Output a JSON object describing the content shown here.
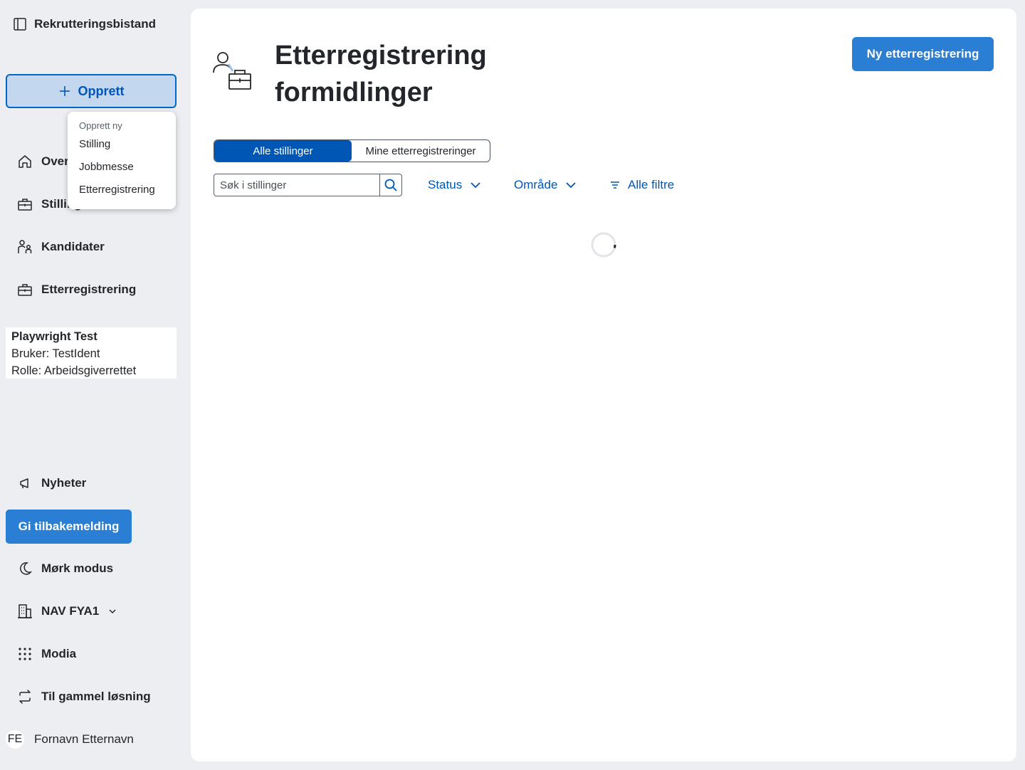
{
  "app": {
    "brand": "Rekrutteringsbistand"
  },
  "sidebar": {
    "create_label": "Opprett",
    "nav": {
      "oversikt": "Oversikt",
      "stillinger": "Stillinger",
      "kandidater": "Kandidater",
      "etterregistrering": "Etterregistrering"
    },
    "user_card": {
      "name": "Playwright Test",
      "user": "Bruker: TestIdent",
      "role": "Rolle: Arbeidsgiverrettet"
    },
    "nyheter": "Nyheter",
    "feedback": "Gi tilbakemelding",
    "dark_mode": "Mørk modus",
    "office": "NAV FYA1",
    "apps": "Modia",
    "old_solution": "Til gammel løsning",
    "avatar_initials": "FE",
    "user_full_name": "Fornavn Etternavn"
  },
  "dropdown": {
    "header": "Opprett ny",
    "options": [
      "Stilling",
      "Jobbmesse",
      "Etterregistrering"
    ]
  },
  "main": {
    "title": "Etterregistrering formidlinger",
    "new_button": "Ny etterregistrering",
    "tabs": [
      "Alle stillinger",
      "Mine etterregistreringer"
    ],
    "active_tab": "Alle stillinger",
    "search_placeholder": "Søk i stillinger",
    "filters": {
      "status": "Status",
      "area": "Område",
      "all": "Alle filtre"
    }
  },
  "colors": {
    "accent": "#0056b4",
    "button_blue": "#2a7ed4",
    "background": "#eceef1",
    "create_bg": "#c3d7ef"
  },
  "icons": {
    "brand": "sidebar-panel-icon",
    "create": "plus-icon",
    "oversikt": "house-icon",
    "stillinger": "briefcase-icon",
    "kandidater": "people-icon",
    "etterregistrering": "briefcase-icon",
    "nyheter": "megaphone-icon",
    "dark_mode": "moon-icon",
    "office": "buildings-icon",
    "office_toggle": "chevron-down-icon",
    "apps": "grid-dots-icon",
    "old_solution": "arrows-circle-icon",
    "search": "magnifier-icon",
    "filter": "filter-lines-icon",
    "page": "person-briefcase-icon",
    "loading": "spinner-icon"
  }
}
